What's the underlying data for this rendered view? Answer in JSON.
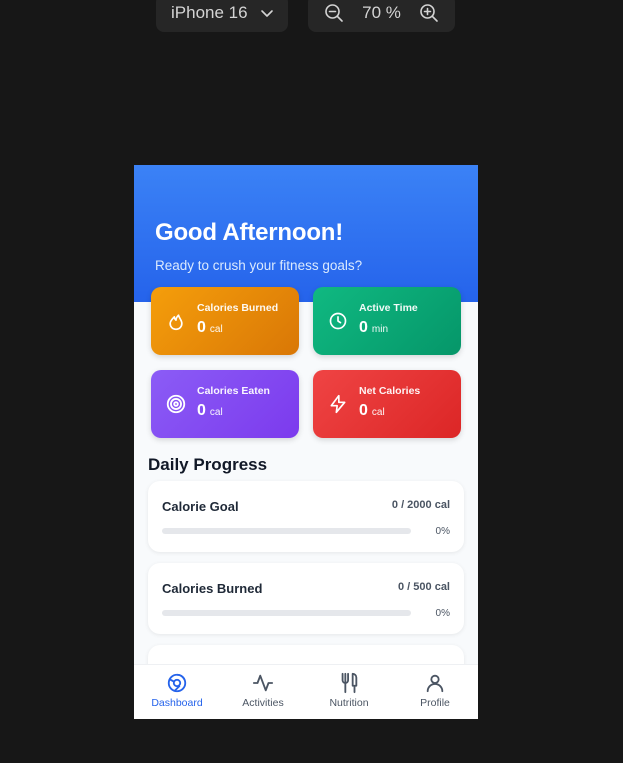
{
  "toolbar": {
    "device": "iPhone 16",
    "zoom": "70 %"
  },
  "app": {
    "greeting": "Good Afternoon!",
    "subtitle": "Ready to crush your fitness goals?",
    "stats": [
      {
        "label": "Calories Burned",
        "value": "0",
        "unit": "cal",
        "icon": "flame-icon",
        "color": "#f59e0b"
      },
      {
        "label": "Active Time",
        "value": "0",
        "unit": "min",
        "icon": "clock-icon",
        "color": "#10b981"
      },
      {
        "label": "Calories Eaten",
        "value": "0",
        "unit": "cal",
        "icon": "target-icon",
        "color": "#8b5cf6"
      },
      {
        "label": "Net Calories",
        "value": "0",
        "unit": "cal",
        "icon": "lightning-icon",
        "color": "#ef4444"
      }
    ],
    "section_title": "Daily Progress",
    "progress": [
      {
        "title": "Calorie Goal",
        "amount": "0 / 2000 cal",
        "percent": "0%",
        "fraction": 0
      },
      {
        "title": "Calories Burned",
        "amount": "0 / 500 cal",
        "percent": "0%",
        "fraction": 0
      }
    ],
    "nav": [
      {
        "label": "Dashboard",
        "icon": "dashboard-icon",
        "active": true
      },
      {
        "label": "Activities",
        "icon": "activity-icon",
        "active": false
      },
      {
        "label": "Nutrition",
        "icon": "fork-knife-icon",
        "active": false
      },
      {
        "label": "Profile",
        "icon": "user-icon",
        "active": false
      }
    ],
    "colors": {
      "accent": "#2563eb",
      "hero": "#3b82f6"
    }
  }
}
